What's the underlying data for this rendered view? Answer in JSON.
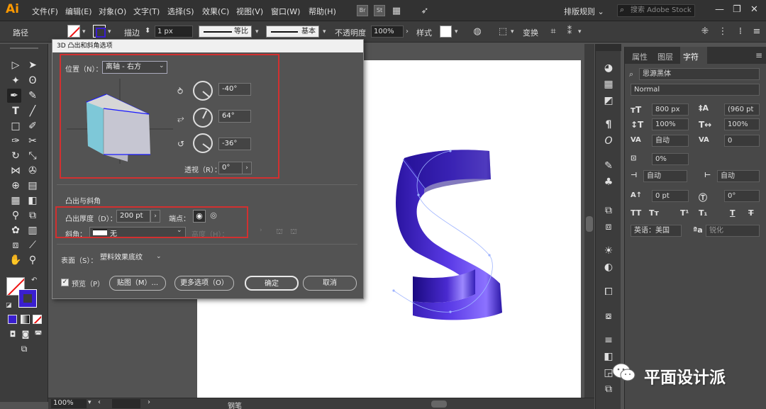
{
  "app": {
    "logo": "Ai"
  },
  "menubar": {
    "items": [
      "文件(F)",
      "编辑(E)",
      "对象(O)",
      "文字(T)",
      "选择(S)",
      "效果(C)",
      "视图(V)",
      "窗口(W)",
      "帮助(H)"
    ],
    "br_label": "Br",
    "st_label": "St",
    "workspace": "排版规则",
    "search_placeholder": "搜索 Adobe Stock"
  },
  "controlbar": {
    "selection_label": "路径",
    "stroke_label": "描边",
    "stroke_weight": "1 px",
    "stroke_style": "等比",
    "brush_style": "基本",
    "opacity_label": "不透明度",
    "opacity_value": "100%",
    "style_label": "样式",
    "transform_label": "变换"
  },
  "statusbar": {
    "zoom": "100%",
    "tool": "钢笔"
  },
  "charpanel": {
    "tabs": [
      "属性",
      "图层",
      "字符"
    ],
    "font_family": "思源黑体",
    "font_style": "Normal",
    "font_size": "800 px",
    "leading": "(960 pt",
    "vertical_scale": "100%",
    "horizontal_scale": "100%",
    "kerning": "自动",
    "tracking": "0",
    "tsume": "0%",
    "aki_left": "自动",
    "aki_right": "自动",
    "baseline_shift": "0 pt",
    "rotation": "0°",
    "language": "英语：美国",
    "antialias": "锐化"
  },
  "dialog": {
    "title": "3D 凸出和斜角选项",
    "position_label": "位置（N）：",
    "position_value": "离轴 - 右方",
    "rot_x": "-40°",
    "rot_y": "64°",
    "rot_z": "-36°",
    "perspective_label": "透视（R）：",
    "perspective_value": "0°",
    "section_extrude": "凸出与斜角",
    "depth_label": "凸出厚度（D）：",
    "depth_value": "200 pt",
    "cap_label": "端点：",
    "bevel_label": "斜角：",
    "bevel_value": "无",
    "height_label": "高度（H）：",
    "surface_label": "表面（S）：",
    "surface_value": "塑料效果底纹",
    "preview_label": "预览（P）",
    "map_art_button": "贴图（M）...",
    "more_options_button": "更多选项（O）",
    "ok_button": "确定",
    "cancel_button": "取消"
  },
  "watermark": {
    "text": "平面设计派"
  },
  "colors": {
    "extrude_fill": "#3a1fb0",
    "cube_front": "#7ec8d8",
    "cube_side": "#c8c8c8",
    "highlight": "#d23030"
  }
}
